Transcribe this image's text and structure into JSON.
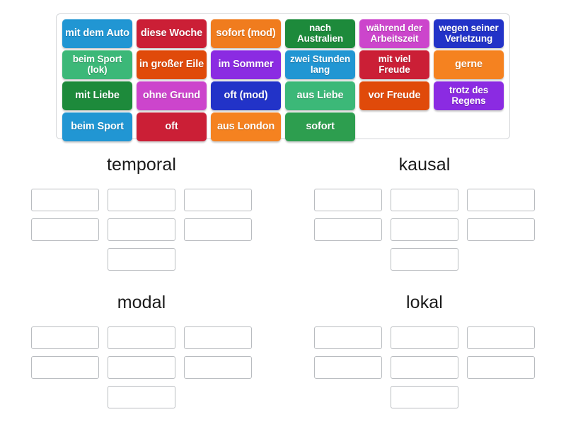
{
  "activity": {
    "type": "group-sort",
    "bank_label": "word-tile-bank"
  },
  "tiles": [
    {
      "label": "mit dem Auto",
      "color": "#2196D3",
      "lines": 1
    },
    {
      "label": "diese Woche",
      "color": "#CB1F36",
      "lines": 1
    },
    {
      "label": "sofort (mod)",
      "color": "#F07C1E",
      "lines": 1
    },
    {
      "label": "nach Australien",
      "color": "#1D8A3B",
      "lines": 2
    },
    {
      "label": "während der Arbeitszeit",
      "color": "#CC45CC",
      "lines": 2
    },
    {
      "label": "wegen seiner Verletzung",
      "color": "#2233C8",
      "lines": 2
    },
    {
      "label": "beim Sport (lok)",
      "color": "#3CB878",
      "lines": 2
    },
    {
      "label": "in großer Eile",
      "color": "#E04A0A",
      "lines": 1
    },
    {
      "label": "im Sommer",
      "color": "#8B2BE2",
      "lines": 1
    },
    {
      "label": "zwei Stunden lang",
      "color": "#2196D3",
      "lines": 2
    },
    {
      "label": "mit viel Freude",
      "color": "#CB1F36",
      "lines": 2
    },
    {
      "label": "gerne",
      "color": "#F58220",
      "lines": 1
    },
    {
      "label": "mit Liebe",
      "color": "#1D8A3B",
      "lines": 1
    },
    {
      "label": "ohne Grund",
      "color": "#CC45CC",
      "lines": 1
    },
    {
      "label": "oft (mod)",
      "color": "#2233C8",
      "lines": 1
    },
    {
      "label": "aus Liebe",
      "color": "#3CB878",
      "lines": 1
    },
    {
      "label": "vor Freude",
      "color": "#E04A0A",
      "lines": 1
    },
    {
      "label": "trotz des Regens",
      "color": "#8B2BE2",
      "lines": 2
    },
    {
      "label": "beim Sport",
      "color": "#2196D3",
      "lines": 1
    },
    {
      "label": "oft",
      "color": "#CB1F36",
      "lines": 1
    },
    {
      "label": "aus London",
      "color": "#F58220",
      "lines": 1
    },
    {
      "label": "sofort",
      "color": "#2D9E4F",
      "lines": 1
    }
  ],
  "bank_rows": [
    [
      0,
      1,
      2,
      3,
      4,
      5
    ],
    [
      6,
      7,
      8,
      9,
      10,
      11
    ],
    [
      12,
      13,
      14,
      15,
      16,
      17
    ],
    [
      18,
      19,
      20,
      21
    ]
  ],
  "groups": [
    {
      "title": "temporal",
      "slot_rows": [
        3,
        3,
        1
      ]
    },
    {
      "title": "kausal",
      "slot_rows": [
        3,
        3,
        1
      ]
    },
    {
      "title": "modal",
      "slot_rows": [
        3,
        3,
        1
      ]
    },
    {
      "title": "lokal",
      "slot_rows": [
        3,
        3,
        1
      ]
    }
  ]
}
